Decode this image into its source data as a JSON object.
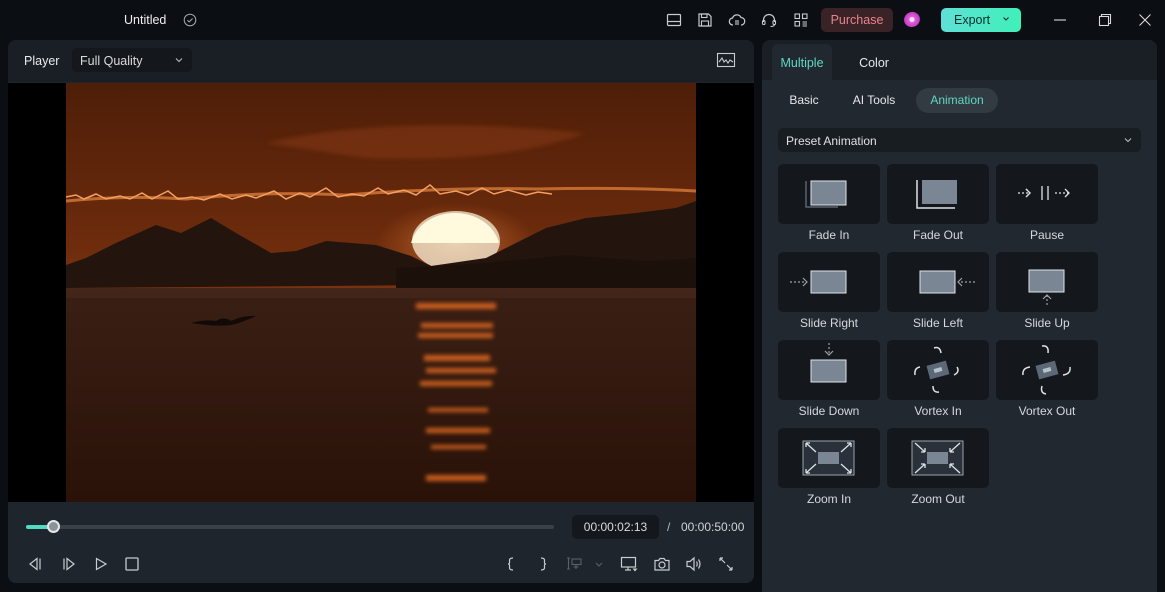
{
  "titlebar": {
    "title": "Untitled",
    "saved_icon": "check-circle-icon",
    "icons": [
      "layout-icon",
      "save-icon",
      "cloud-upload-icon",
      "headset-icon",
      "apps-grid-icon"
    ],
    "purchase_label": "Purchase",
    "export_label": "Export",
    "window_controls": [
      "minimize-icon",
      "restore-icon",
      "close-icon"
    ]
  },
  "player": {
    "label": "Player",
    "quality": "Full Quality",
    "current_time": "00:00:02:13",
    "separator": "/",
    "total_time": "00:00:50:00",
    "progress": 0.052,
    "controls_left": [
      "prev-frame-icon",
      "next-frame-icon",
      "play-icon",
      "stop-icon"
    ],
    "controls_right": [
      "mark-in-icon",
      "mark-out-icon",
      "insert-marker-icon",
      "chevron-down-icon",
      "display-icon",
      "snapshot-icon",
      "volume-icon",
      "fullscreen-icon"
    ]
  },
  "panel": {
    "tabs": [
      {
        "label": "Multiple",
        "active": true
      },
      {
        "label": "Color",
        "active": false
      }
    ],
    "subtabs": [
      {
        "label": "Basic",
        "active": false
      },
      {
        "label": "AI Tools",
        "active": false
      },
      {
        "label": "Animation",
        "active": true
      }
    ],
    "preset_select": "Preset Animation",
    "animations": [
      {
        "label": "Fade In",
        "icon": "fade-in"
      },
      {
        "label": "Fade Out",
        "icon": "fade-out"
      },
      {
        "label": "Pause",
        "icon": "pause"
      },
      {
        "label": "Slide Right",
        "icon": "slide-right"
      },
      {
        "label": "Slide Left",
        "icon": "slide-left"
      },
      {
        "label": "Slide Up",
        "icon": "slide-up"
      },
      {
        "label": "Slide Down",
        "icon": "slide-down"
      },
      {
        "label": "Vortex In",
        "icon": "vortex-in"
      },
      {
        "label": "Vortex Out",
        "icon": "vortex-out"
      },
      {
        "label": "Zoom In",
        "icon": "zoom-in"
      },
      {
        "label": "Zoom Out",
        "icon": "zoom-out"
      }
    ]
  },
  "colors": {
    "accent": "#52d9c2",
    "purchase_text": "#e8838d",
    "export_start": "#5fe0d6",
    "export_end": "#3ff0b8"
  }
}
